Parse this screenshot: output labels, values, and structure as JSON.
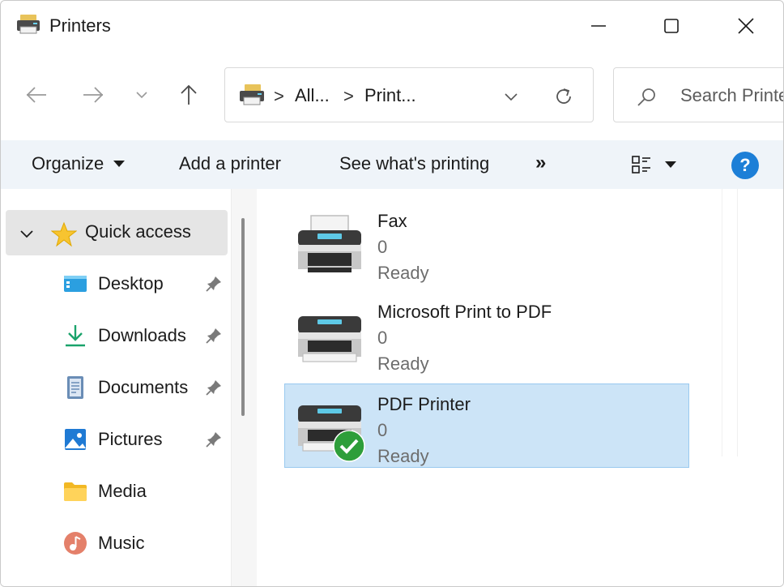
{
  "window": {
    "title": "Printers",
    "controls": [
      "minimize",
      "maximize",
      "close"
    ]
  },
  "navigation": {
    "back_icon": "arrow-left-icon",
    "forward_icon": "arrow-right-icon",
    "recent_icon": "chevron-down-icon",
    "up_icon": "arrow-up-icon",
    "address": {
      "crumbs": [
        "All...",
        "Print..."
      ],
      "separator": ">"
    },
    "search": {
      "placeholder": "Search Printers"
    }
  },
  "command_bar": {
    "organize": "Organize",
    "add_printer": "Add a printer",
    "see_printing": "See what's printing",
    "more": "»",
    "help": "?"
  },
  "sidebar": {
    "quick_access": "Quick access",
    "items": [
      {
        "label": "Desktop",
        "icon": "desktop-icon",
        "pinned": true
      },
      {
        "label": "Downloads",
        "icon": "download-arrow-icon",
        "pinned": true
      },
      {
        "label": "Documents",
        "icon": "document-icon",
        "pinned": true
      },
      {
        "label": "Pictures",
        "icon": "pictures-icon",
        "pinned": true
      },
      {
        "label": "Media",
        "icon": "folder-icon",
        "pinned": false
      },
      {
        "label": "Music",
        "icon": "music-icon",
        "pinned": false
      }
    ]
  },
  "printers": [
    {
      "name": "Fax",
      "jobs": "0",
      "status": "Ready",
      "selected": false,
      "default": false
    },
    {
      "name": "Microsoft Print to PDF",
      "jobs": "0",
      "status": "Ready",
      "selected": false,
      "default": false
    },
    {
      "name": "PDF Printer",
      "jobs": "0",
      "status": "Ready",
      "selected": true,
      "default": true
    }
  ],
  "colors": {
    "accent": "#1d7fd7",
    "selection": "#cce4f7",
    "selection_border": "#99c9ef",
    "command_bar": "#eff4f9",
    "default_badge": "#2e9e3a"
  }
}
